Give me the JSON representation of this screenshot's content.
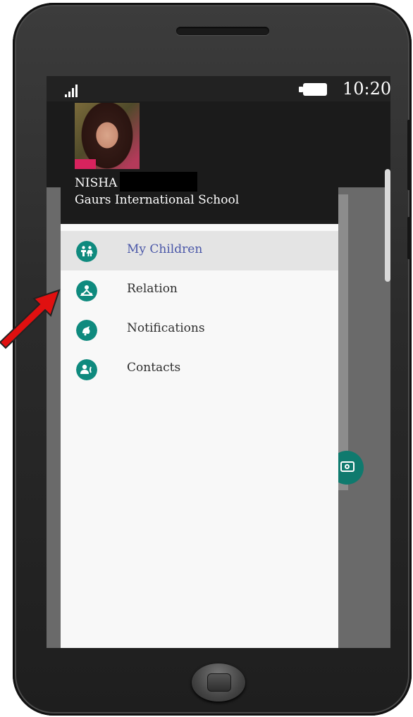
{
  "status_bar": {
    "time": "10:20"
  },
  "profile": {
    "name": "NISHA",
    "school": "Gaurs International School"
  },
  "menu": {
    "items": [
      {
        "label": "My Children",
        "icon": "children-icon",
        "active": true
      },
      {
        "label": "Relation",
        "icon": "relation-icon",
        "active": false
      },
      {
        "label": "Notifications",
        "icon": "notification-icon",
        "active": false
      },
      {
        "label": "Contacts",
        "icon": "contacts-icon",
        "active": false
      }
    ]
  },
  "colors": {
    "accent": "#0f8a7e",
    "active_text": "#4a57a8",
    "annotation_arrow": "#e01010"
  }
}
